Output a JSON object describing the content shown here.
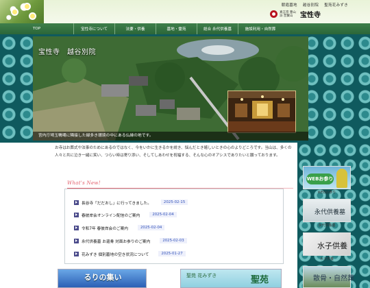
{
  "header": {
    "links": [
      "朝霞墓地",
      "越谷別院",
      "聖苑花みずき"
    ],
    "logo_sub": "真言宗 豊山派 普賢山",
    "logo_main": "宝性寺"
  },
  "nav": {
    "items": [
      "TOP",
      "宝性寺について",
      "法要・供養",
      "墓地・霊苑",
      "総合 永代供養墓",
      "施設利用・自然葬"
    ]
  },
  "hero": {
    "title": "宝性寺　越谷別院",
    "caption": "宮内庁埼玉鴨場に隣接した緑多き環境の中にある仏縁の地です。"
  },
  "intro": {
    "text": "お寺はお葬式や法事のためにあるのではなく、今をいかに生きるかを説き、悩んだとき嬉しいときの心のよりどころです。当山は、多くの人々と共に泣き一緒に笑い、つらい時は寄り添い、そしてしあわせを祝福する、そんな心のオアシスでありたいと願っております。"
  },
  "news": {
    "label": "What's New!",
    "items": [
      {
        "text": "長谷寺「だだおし」に行ってきました。",
        "date": "2025-02-15"
      },
      {
        "text": "春彼岸会オンライン配信のご案内",
        "date": "2025-02-04"
      },
      {
        "text": "令和7年 春彼岸会のご案内",
        "date": "2025-02-04"
      },
      {
        "text": "永代供養墓 お還骨 対面お参りのご案内",
        "date": "2025-02-03"
      },
      {
        "text": "花みずき 個別墓地の空き状況について",
        "date": "2025-01-27"
      }
    ]
  },
  "sidebar": {
    "banners": [
      {
        "caption": "WEBお参り",
        "art": "WEBお参り"
      },
      {
        "caption": "永代供養墓",
        "art": "永代供養墓"
      },
      {
        "caption": "水子供養",
        "art": "水子供養"
      },
      {
        "caption": "",
        "art": "散骨・自然葬"
      }
    ]
  },
  "bottom": {
    "left_art": "るりの集い",
    "right_art_top": "聖苑 花みずき",
    "right_art_main": "聖苑"
  },
  "colors": {
    "nav_green": "#2b6638",
    "pattern_teal": "#0f5a5e",
    "date_blue": "#2e4fb8",
    "whatsnew_pink": "#e25d6a"
  }
}
